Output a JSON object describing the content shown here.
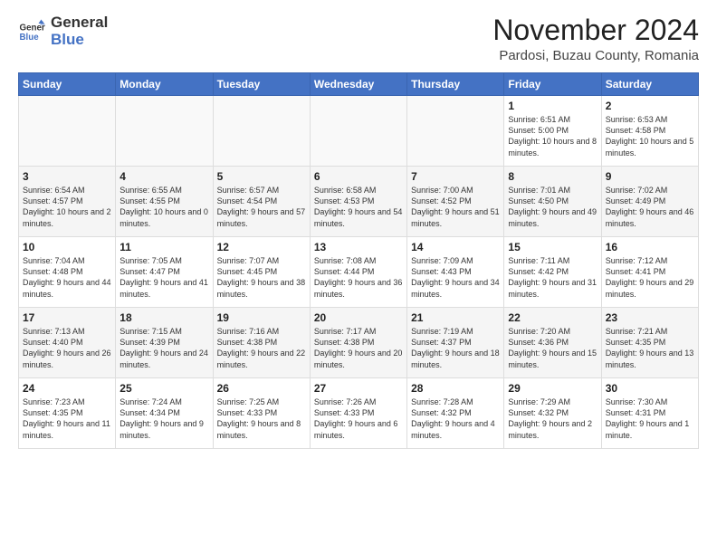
{
  "logo": {
    "text_general": "General",
    "text_blue": "Blue"
  },
  "title": "November 2024",
  "subtitle": "Pardosi, Buzau County, Romania",
  "headers": [
    "Sunday",
    "Monday",
    "Tuesday",
    "Wednesday",
    "Thursday",
    "Friday",
    "Saturday"
  ],
  "weeks": [
    [
      {
        "day": "",
        "info": ""
      },
      {
        "day": "",
        "info": ""
      },
      {
        "day": "",
        "info": ""
      },
      {
        "day": "",
        "info": ""
      },
      {
        "day": "",
        "info": ""
      },
      {
        "day": "1",
        "info": "Sunrise: 6:51 AM\nSunset: 5:00 PM\nDaylight: 10 hours and 8 minutes."
      },
      {
        "day": "2",
        "info": "Sunrise: 6:53 AM\nSunset: 4:58 PM\nDaylight: 10 hours and 5 minutes."
      }
    ],
    [
      {
        "day": "3",
        "info": "Sunrise: 6:54 AM\nSunset: 4:57 PM\nDaylight: 10 hours and 2 minutes."
      },
      {
        "day": "4",
        "info": "Sunrise: 6:55 AM\nSunset: 4:55 PM\nDaylight: 10 hours and 0 minutes."
      },
      {
        "day": "5",
        "info": "Sunrise: 6:57 AM\nSunset: 4:54 PM\nDaylight: 9 hours and 57 minutes."
      },
      {
        "day": "6",
        "info": "Sunrise: 6:58 AM\nSunset: 4:53 PM\nDaylight: 9 hours and 54 minutes."
      },
      {
        "day": "7",
        "info": "Sunrise: 7:00 AM\nSunset: 4:52 PM\nDaylight: 9 hours and 51 minutes."
      },
      {
        "day": "8",
        "info": "Sunrise: 7:01 AM\nSunset: 4:50 PM\nDaylight: 9 hours and 49 minutes."
      },
      {
        "day": "9",
        "info": "Sunrise: 7:02 AM\nSunset: 4:49 PM\nDaylight: 9 hours and 46 minutes."
      }
    ],
    [
      {
        "day": "10",
        "info": "Sunrise: 7:04 AM\nSunset: 4:48 PM\nDaylight: 9 hours and 44 minutes."
      },
      {
        "day": "11",
        "info": "Sunrise: 7:05 AM\nSunset: 4:47 PM\nDaylight: 9 hours and 41 minutes."
      },
      {
        "day": "12",
        "info": "Sunrise: 7:07 AM\nSunset: 4:45 PM\nDaylight: 9 hours and 38 minutes."
      },
      {
        "day": "13",
        "info": "Sunrise: 7:08 AM\nSunset: 4:44 PM\nDaylight: 9 hours and 36 minutes."
      },
      {
        "day": "14",
        "info": "Sunrise: 7:09 AM\nSunset: 4:43 PM\nDaylight: 9 hours and 34 minutes."
      },
      {
        "day": "15",
        "info": "Sunrise: 7:11 AM\nSunset: 4:42 PM\nDaylight: 9 hours and 31 minutes."
      },
      {
        "day": "16",
        "info": "Sunrise: 7:12 AM\nSunset: 4:41 PM\nDaylight: 9 hours and 29 minutes."
      }
    ],
    [
      {
        "day": "17",
        "info": "Sunrise: 7:13 AM\nSunset: 4:40 PM\nDaylight: 9 hours and 26 minutes."
      },
      {
        "day": "18",
        "info": "Sunrise: 7:15 AM\nSunset: 4:39 PM\nDaylight: 9 hours and 24 minutes."
      },
      {
        "day": "19",
        "info": "Sunrise: 7:16 AM\nSunset: 4:38 PM\nDaylight: 9 hours and 22 minutes."
      },
      {
        "day": "20",
        "info": "Sunrise: 7:17 AM\nSunset: 4:38 PM\nDaylight: 9 hours and 20 minutes."
      },
      {
        "day": "21",
        "info": "Sunrise: 7:19 AM\nSunset: 4:37 PM\nDaylight: 9 hours and 18 minutes."
      },
      {
        "day": "22",
        "info": "Sunrise: 7:20 AM\nSunset: 4:36 PM\nDaylight: 9 hours and 15 minutes."
      },
      {
        "day": "23",
        "info": "Sunrise: 7:21 AM\nSunset: 4:35 PM\nDaylight: 9 hours and 13 minutes."
      }
    ],
    [
      {
        "day": "24",
        "info": "Sunrise: 7:23 AM\nSunset: 4:35 PM\nDaylight: 9 hours and 11 minutes."
      },
      {
        "day": "25",
        "info": "Sunrise: 7:24 AM\nSunset: 4:34 PM\nDaylight: 9 hours and 9 minutes."
      },
      {
        "day": "26",
        "info": "Sunrise: 7:25 AM\nSunset: 4:33 PM\nDaylight: 9 hours and 8 minutes."
      },
      {
        "day": "27",
        "info": "Sunrise: 7:26 AM\nSunset: 4:33 PM\nDaylight: 9 hours and 6 minutes."
      },
      {
        "day": "28",
        "info": "Sunrise: 7:28 AM\nSunset: 4:32 PM\nDaylight: 9 hours and 4 minutes."
      },
      {
        "day": "29",
        "info": "Sunrise: 7:29 AM\nSunset: 4:32 PM\nDaylight: 9 hours and 2 minutes."
      },
      {
        "day": "30",
        "info": "Sunrise: 7:30 AM\nSunset: 4:31 PM\nDaylight: 9 hours and 1 minute."
      }
    ]
  ]
}
